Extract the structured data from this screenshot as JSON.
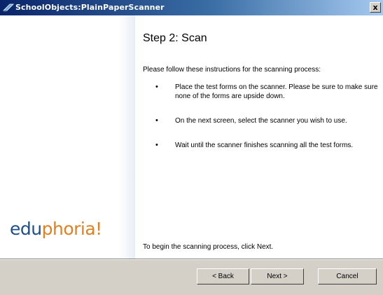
{
  "window": {
    "title": "SchoolObjects:PlainPaperScanner",
    "close_label": "x"
  },
  "branding": {
    "logo_part1": "edu",
    "logo_part2": "phoria!"
  },
  "step": {
    "title": "Step 2: Scan",
    "intro": "Please follow these instructions for the scanning process:",
    "bullets": [
      {
        "text": "Place the test forms on the scanner.  Please be sure to make sure none of the forms are upside down."
      },
      {
        "text": "On the next screen, select the scanner you wish to use."
      },
      {
        "text": "Wait until the scanner finishes scanning all the test forms."
      }
    ],
    "footer": "To begin the scanning process, click Next."
  },
  "buttons": {
    "back": "< Back",
    "next": "Next >",
    "cancel": "Cancel"
  },
  "colors": {
    "title_bar_start": "#0a246a",
    "title_bar_end": "#a6caf0",
    "logo_blue": "#1f4e8c",
    "logo_orange": "#e0801f",
    "dialog_face": "#d4d0c8"
  }
}
